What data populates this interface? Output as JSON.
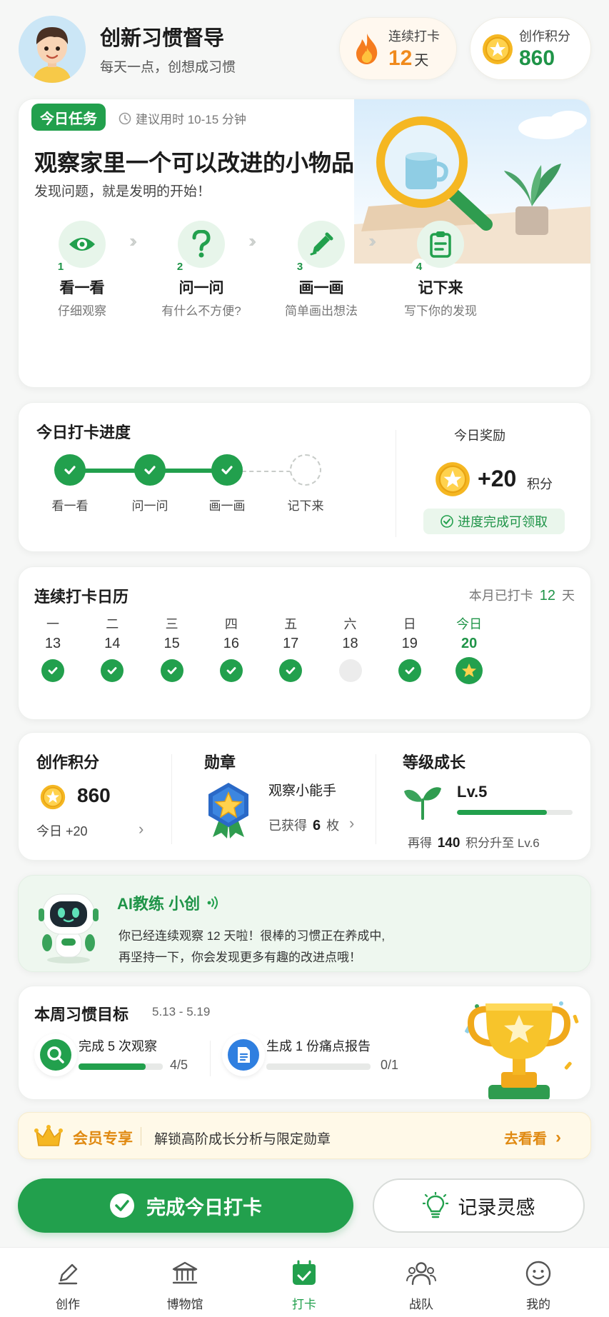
{
  "header": {
    "title": "创新习惯督导",
    "subtitle": "每天一点，创想成习惯",
    "streak_label": "连续打卡",
    "streak_value": "12",
    "streak_unit": "天",
    "points_label": "创作积分",
    "points_value": "860"
  },
  "task": {
    "badge": "今日任务",
    "time_hint": "建议用时 10-15 分钟",
    "title": "观察家里一个可以改进的小物品",
    "subtitle": "发现问题，就是发明的开始！",
    "steps": [
      {
        "num": "1",
        "title": "看一看",
        "desc": "仔细观察",
        "icon": "eye-icon"
      },
      {
        "num": "2",
        "title": "问一问",
        "desc": "有什么不方便?",
        "icon": "question-icon"
      },
      {
        "num": "3",
        "title": "画一画",
        "desc": "简单画出想法",
        "icon": "pencil-icon"
      },
      {
        "num": "4",
        "title": "记下来",
        "desc": "写下你的发现",
        "icon": "clipboard-icon"
      }
    ]
  },
  "progress": {
    "title": "今日打卡进度",
    "steps": [
      {
        "label": "看一看",
        "done": true
      },
      {
        "label": "问一问",
        "done": true
      },
      {
        "label": "画一画",
        "done": true
      },
      {
        "label": "记下来",
        "done": false
      }
    ],
    "reward_title": "今日奖励",
    "reward_value": "+20",
    "reward_unit": "积分",
    "reward_hint": "进度完成可领取"
  },
  "calendar": {
    "title": "连续打卡日历",
    "month_prefix": "本月已打卡",
    "month_count": "12",
    "month_unit": "天",
    "days": [
      {
        "weekday": "一",
        "date": "13",
        "state": "done"
      },
      {
        "weekday": "二",
        "date": "14",
        "state": "done"
      },
      {
        "weekday": "三",
        "date": "15",
        "state": "done"
      },
      {
        "weekday": "四",
        "date": "16",
        "state": "done"
      },
      {
        "weekday": "五",
        "date": "17",
        "state": "done"
      },
      {
        "weekday": "六",
        "date": "18",
        "state": "missed"
      },
      {
        "weekday": "日",
        "date": "19",
        "state": "done"
      },
      {
        "weekday": "今日",
        "date": "20",
        "state": "today"
      }
    ]
  },
  "stats": {
    "points_title": "创作积分",
    "points_value": "860",
    "points_today": "今日 +20",
    "medal_title": "勋章",
    "medal_name": "观察小能手",
    "medal_count_prefix": "已获得",
    "medal_count": "6",
    "medal_count_unit": "枚",
    "level_title": "等级成长",
    "level_value": "Lv.5",
    "level_progress": 0.78,
    "level_hint_prefix": "再得",
    "level_hint_num": "140",
    "level_hint_suffix": "积分升至 Lv.6"
  },
  "coach": {
    "name": "AI教练 小创",
    "line1": "你已经连续观察 12 天啦！很棒的习惯正在养成中,",
    "line2": "再坚持一下，你会发现更多有趣的改进点哦！"
  },
  "weekly": {
    "title": "本周习惯目标",
    "range": "5.13 - 5.19",
    "goals": [
      {
        "label": "完成 5 次观察",
        "progress": "4/5",
        "ratio": 0.8,
        "icon": "search-icon"
      },
      {
        "label": "生成 1 份痛点报告",
        "progress": "0/1",
        "ratio": 0,
        "icon": "document-icon"
      }
    ]
  },
  "vip": {
    "label": "会员专享",
    "desc": "解锁高阶成长分析与限定勋章",
    "action": "去看看"
  },
  "actions": {
    "primary": "完成今日打卡",
    "secondary": "记录灵感"
  },
  "nav": [
    {
      "label": "创作",
      "icon": "pencil-icon"
    },
    {
      "label": "博物馆",
      "icon": "museum-icon"
    },
    {
      "label": "打卡",
      "icon": "calendar-check-icon"
    },
    {
      "label": "战队",
      "icon": "team-icon"
    },
    {
      "label": "我的",
      "icon": "smile-icon"
    }
  ],
  "colors": {
    "primary": "#22a04d",
    "accent_orange": "#f08a1c",
    "gold": "#f5b722"
  }
}
